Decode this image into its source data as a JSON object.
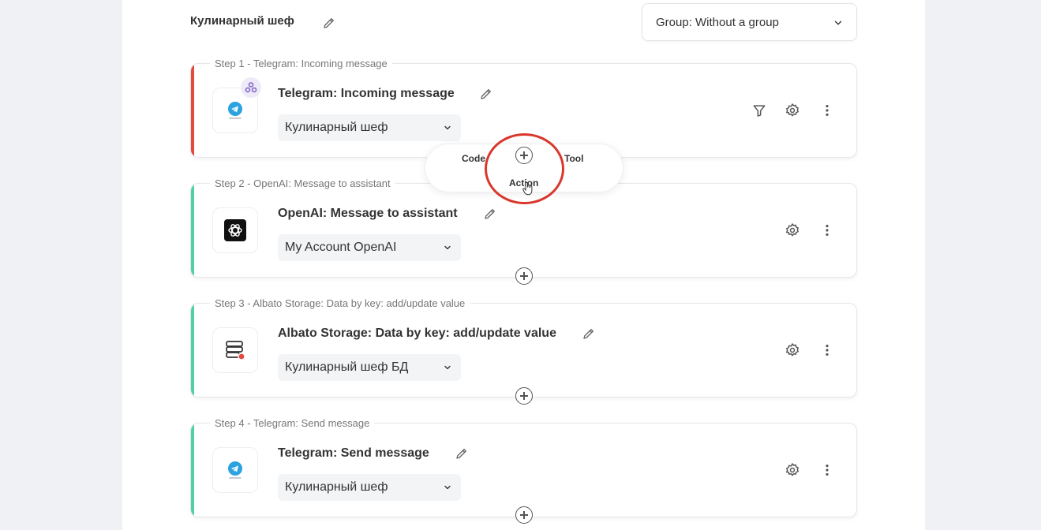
{
  "header": {
    "title": "Кулинарный шеф",
    "group_select": "Group: Without a group"
  },
  "steps": [
    {
      "label": "Step 1 - Telegram: Incoming message",
      "title": "Telegram: Incoming message",
      "account": "Кулинарный шеф",
      "app_icon": "telegram-icon",
      "bar_color": "#e5483c"
    },
    {
      "label": "Step 2 - OpenAI: Message to assistant",
      "title": "OpenAI: Message to assistant",
      "account": "My Account OpenAI",
      "app_icon": "openai-icon",
      "bar_color": "#4fd1a1"
    },
    {
      "label": "Step 3 - Albato Storage: Data by key: add/update value",
      "title": "Albato Storage: Data by key: add/update value",
      "account": "Кулинарный шеф БД",
      "app_icon": "storage-icon",
      "bar_color": "#4fd1a1"
    },
    {
      "label": "Step 4 - Telegram: Send message",
      "title": "Telegram: Send message",
      "account": "Кулинарный шеф",
      "app_icon": "telegram-icon",
      "bar_color": "#4fd1a1"
    }
  ],
  "add_popup": {
    "code": "Code",
    "action": "Action",
    "tool": "Tool"
  },
  "colors": {
    "accent_red": "#d9362c",
    "success_green": "#4fd1a1"
  }
}
